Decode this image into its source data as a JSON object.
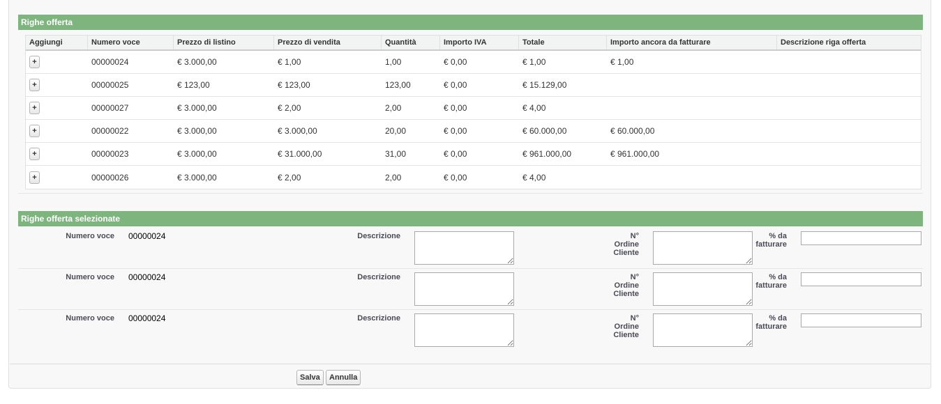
{
  "offer_lines": {
    "title": "Righe offerta",
    "columns": [
      "Aggiungi",
      "Numero voce",
      "Prezzo di listino",
      "Prezzo di vendita",
      "Quantità",
      "Importo IVA",
      "Totale",
      "Importo ancora da fatturare",
      "Descrizione riga offerta"
    ],
    "add_label": "+",
    "rows": [
      {
        "numero": "00000024",
        "listino": "€ 3.000,00",
        "vendita": "€ 1,00",
        "quantita": "1,00",
        "iva": "€ 0,00",
        "totale": "€ 1,00",
        "da_fatturare": "€ 1,00",
        "descrizione": ""
      },
      {
        "numero": "00000025",
        "listino": "€ 123,00",
        "vendita": "€ 123,00",
        "quantita": "123,00",
        "iva": "€ 0,00",
        "totale": "€ 15.129,00",
        "da_fatturare": "",
        "descrizione": ""
      },
      {
        "numero": "00000027",
        "listino": "€ 3.000,00",
        "vendita": "€ 2,00",
        "quantita": "2,00",
        "iva": "€ 0,00",
        "totale": "€ 4,00",
        "da_fatturare": "",
        "descrizione": ""
      },
      {
        "numero": "00000022",
        "listino": "€ 3.000,00",
        "vendita": "€ 3.000,00",
        "quantita": "20,00",
        "iva": "€ 0,00",
        "totale": "€ 60.000,00",
        "da_fatturare": "€ 60.000,00",
        "descrizione": ""
      },
      {
        "numero": "00000023",
        "listino": "€ 3.000,00",
        "vendita": "€ 31.000,00",
        "quantita": "31,00",
        "iva": "€ 0,00",
        "totale": "€ 961.000,00",
        "da_fatturare": "€ 961.000,00",
        "descrizione": ""
      },
      {
        "numero": "00000026",
        "listino": "€ 3.000,00",
        "vendita": "€ 2,00",
        "quantita": "2,00",
        "iva": "€ 0,00",
        "totale": "€ 4,00",
        "da_fatturare": "",
        "descrizione": ""
      }
    ]
  },
  "selected_lines": {
    "title": "Righe offerta selezionate",
    "label_numero": "Numero voce",
    "label_descrizione": "Descrizione",
    "label_ordine": [
      "N°",
      "Ordine",
      "Cliente"
    ],
    "label_percent": [
      "% da",
      "fatturare"
    ],
    "rows": [
      {
        "numero": "00000024",
        "descrizione": "",
        "ordine_cliente": "",
        "percent": ""
      },
      {
        "numero": "00000024",
        "descrizione": "",
        "ordine_cliente": "",
        "percent": ""
      },
      {
        "numero": "00000024",
        "descrizione": "",
        "ordine_cliente": "",
        "percent": ""
      }
    ]
  },
  "footer": {
    "save_label": "Salva",
    "cancel_label": "Annulla"
  },
  "colors": {
    "section_header": "#7eb57e",
    "panel_background": "#f8f8f8"
  }
}
